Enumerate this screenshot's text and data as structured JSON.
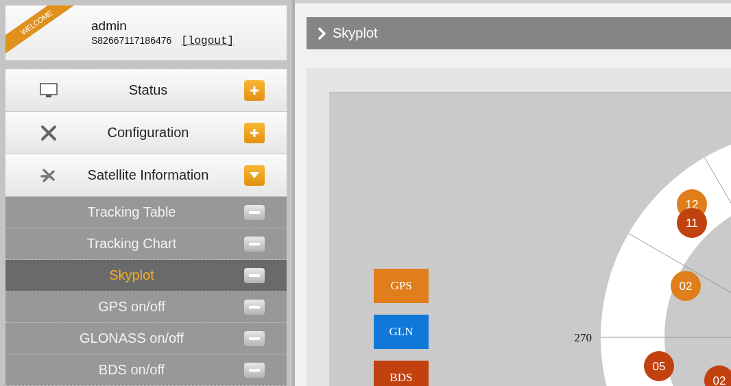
{
  "user": {
    "ribbon": "WELCOME",
    "name": "admin",
    "serial": "S82667117186476",
    "logout": "[logout]"
  },
  "menu": [
    {
      "label": "Status",
      "expanded": false
    },
    {
      "label": "Configuration",
      "expanded": false
    },
    {
      "label": "Satellite Information",
      "expanded": true,
      "children": [
        {
          "label": "Tracking Table",
          "selected": false
        },
        {
          "label": "Tracking Chart",
          "selected": false
        },
        {
          "label": "Skyplot",
          "selected": true
        },
        {
          "label": "GPS on/off",
          "selected": false
        },
        {
          "label": "GLONASS on/off",
          "selected": false
        },
        {
          "label": "BDS on/off",
          "selected": false
        }
      ]
    }
  ],
  "page_title": "Skyplot",
  "skyplot": {
    "legend": [
      {
        "label": "GPS",
        "color": "#e07e1c"
      },
      {
        "label": "GLN",
        "color": "#0f78d8"
      },
      {
        "label": "BDS",
        "color": "#c2420f"
      }
    ],
    "azimuth_label": "270",
    "satellites": [
      {
        "label": "12",
        "color": "#e07e1c"
      },
      {
        "label": "11",
        "color": "#c2420f"
      },
      {
        "label": "02",
        "color": "#e07e1c"
      },
      {
        "label": "05",
        "color": "#c2420f"
      },
      {
        "label": "02",
        "color": "#c2420f"
      }
    ]
  }
}
